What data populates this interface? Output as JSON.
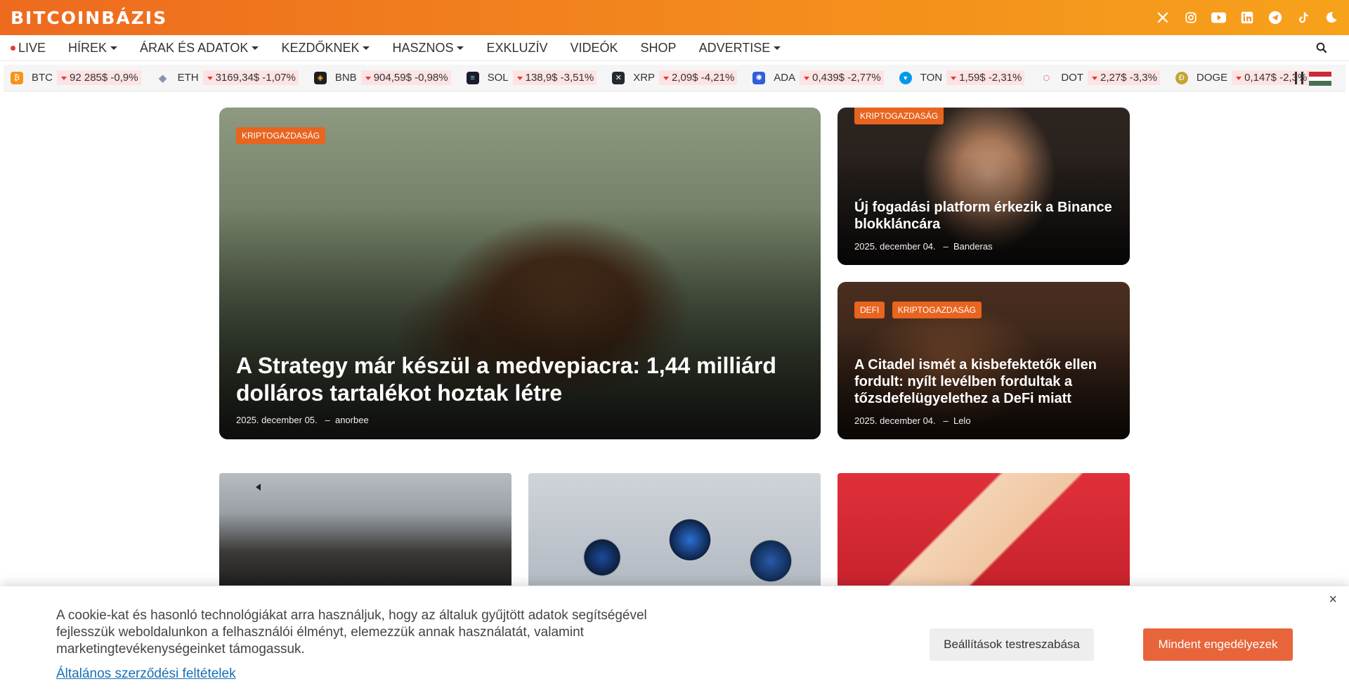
{
  "brand": {
    "logo": "BITCOINBÁZIS"
  },
  "socials": [
    "x-icon",
    "instagram-icon",
    "youtube-icon",
    "linkedin-icon",
    "telegram-icon",
    "tiktok-icon",
    "dark-mode-icon"
  ],
  "nav": {
    "live": "LIVE",
    "items": [
      {
        "label": "HÍREK",
        "dropdown": true
      },
      {
        "label": "ÁRAK ÉS ADATOK",
        "dropdown": true
      },
      {
        "label": "KEZDŐKNEK",
        "dropdown": true
      },
      {
        "label": "HASZNOS",
        "dropdown": true
      },
      {
        "label": "EXKLUZÍV",
        "dropdown": false
      },
      {
        "label": "VIDEÓK",
        "dropdown": false
      },
      {
        "label": "SHOP",
        "dropdown": false
      },
      {
        "label": "ADVERTISE",
        "dropdown": true
      }
    ]
  },
  "ticker": [
    {
      "symbol": "BTC",
      "value": "92 285$ -0,9%",
      "color": "#f7931a",
      "glyph": "₿"
    },
    {
      "symbol": "ETH",
      "value": "3169,34$ -1,07%",
      "color": "#8a92b2",
      "glyph": "◆"
    },
    {
      "symbol": "BNB",
      "value": "904,59$ -0,98%",
      "color": "#1e1e1e",
      "glyph": "◈"
    },
    {
      "symbol": "SOL",
      "value": "138,9$ -3,51%",
      "color": "#1b1b2e",
      "glyph": "≡"
    },
    {
      "symbol": "XRP",
      "value": "2,09$ -4,21%",
      "color": "#23292f",
      "glyph": "✕"
    },
    {
      "symbol": "ADA",
      "value": "0,439$ -2,77%",
      "color": "#0033ad",
      "glyph": "✺"
    },
    {
      "symbol": "TON",
      "value": "1,59$ -2,31%",
      "color": "#0098ea",
      "glyph": "▼"
    },
    {
      "symbol": "DOT",
      "value": "2,27$ -3,3%",
      "color": "#e6007a",
      "glyph": "○"
    },
    {
      "symbol": "DOGE",
      "value": "0,147$ -2,3%",
      "color": "#c2a633",
      "glyph": "Ð"
    }
  ],
  "hero": {
    "main": {
      "tags": [
        "KRIPTOGAZDASÁG"
      ],
      "title": "A Strategy már készül a medvepiacra: 1,44 milliárd dolláros tartalékot hoztak létre",
      "date": "2025. december 05.",
      "author": "anorbee"
    },
    "side1": {
      "tags": [
        "KRIPTOGAZDASÁG"
      ],
      "title": "Új fogadási platform érkezik a Binance blokkláncára",
      "date": "2025. december 04.",
      "author": "Banderas"
    },
    "side2": {
      "tags": [
        "DEFI",
        "KRIPTOGAZDASÁG"
      ],
      "title": "A Citadel ismét a kisbefektetők ellen fordult: nyílt levélben fordultak a tőzsdefelügyelethez a DeFi miatt",
      "date": "2025. december 04.",
      "author": "Lelo"
    }
  },
  "cookie": {
    "text": "A cookie-kat és hasonló technológiákat arra használjuk, hogy az általuk gyűjtött adatok segítségével fejlesszük weboldalunkon a felhasználói élményt, elemezzük annak használatát, valamint marketingtevékenységeinket támogassuk.",
    "link": "Általános szerződési feltételek",
    "settings_button": "Beállítások testreszabása",
    "allow_button": "Mindent engedélyezek",
    "close": "×"
  }
}
